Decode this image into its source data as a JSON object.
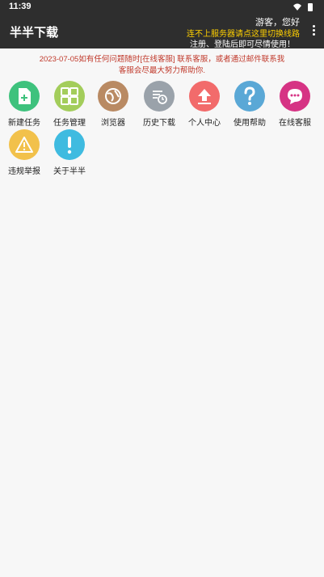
{
  "status": {
    "time": "11:39"
  },
  "app": {
    "title": "半半下载",
    "greeting": "游客，您好",
    "switch_line": "连不上服务器请点这里切换线路",
    "login_hint": "注册、登陆后即可尽情使用！"
  },
  "notice": {
    "line1": "2023-07-05如有任何问题随时[在线客服] 联系客服，或者通过邮件联系我",
    "line2": "客服会尽最大努力帮助你."
  },
  "menu": [
    {
      "label": "新建任务",
      "icon": "new-task-icon",
      "color": "#3ec27d"
    },
    {
      "label": "任务管理",
      "icon": "task-manage-icon",
      "color": "#a3cd5b"
    },
    {
      "label": "浏览器",
      "icon": "browser-icon",
      "color": "#b98a63"
    },
    {
      "label": "历史下载",
      "icon": "history-download-icon",
      "color": "#9aa2aa"
    },
    {
      "label": "个人中心",
      "icon": "personal-center-icon",
      "color": "#f26b6b"
    },
    {
      "label": "使用帮助",
      "icon": "help-icon",
      "color": "#5aa8d6"
    },
    {
      "label": "在线客服",
      "icon": "online-service-icon",
      "color": "#d63384"
    },
    {
      "label": "违规举报",
      "icon": "report-icon",
      "color": "#f2c14b"
    },
    {
      "label": "关于半半",
      "icon": "about-icon",
      "color": "#3fbbe0"
    }
  ]
}
